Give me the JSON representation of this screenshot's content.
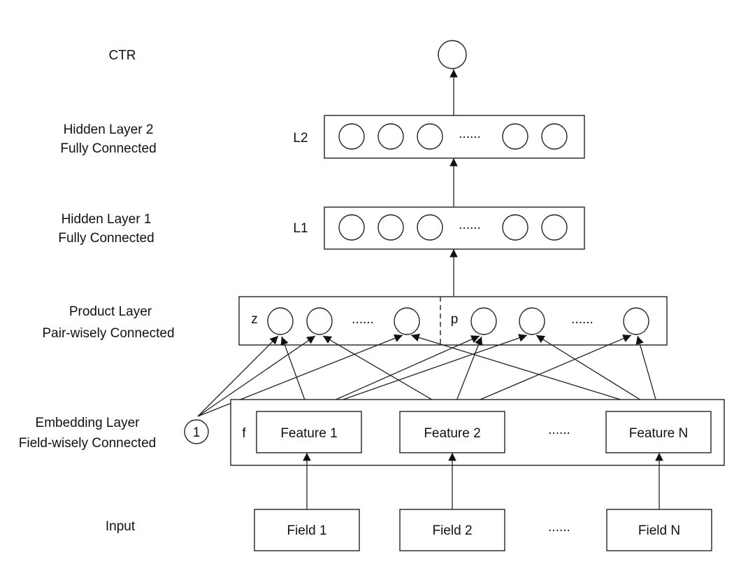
{
  "labels": {
    "ctr": "CTR",
    "hidden2_a": "Hidden Layer 2",
    "hidden2_b": "Fully Connected",
    "hidden1_a": "Hidden Layer 1",
    "hidden1_b": "Fully Connected",
    "product_a": "Product Layer",
    "product_b": "Pair-wisely Connected",
    "embedding_a": "Embedding Layer",
    "embedding_b": "Field-wisely Connected",
    "input": "Input"
  },
  "layers": {
    "l2": "L2",
    "l1": "L1",
    "z": "z",
    "p": "p",
    "f": "f",
    "bias": "1",
    "ellipsis": "......"
  },
  "features": [
    "Feature 1",
    "Feature 2",
    "Feature N"
  ],
  "fields": [
    "Field 1",
    "Field 2",
    "Field N"
  ]
}
